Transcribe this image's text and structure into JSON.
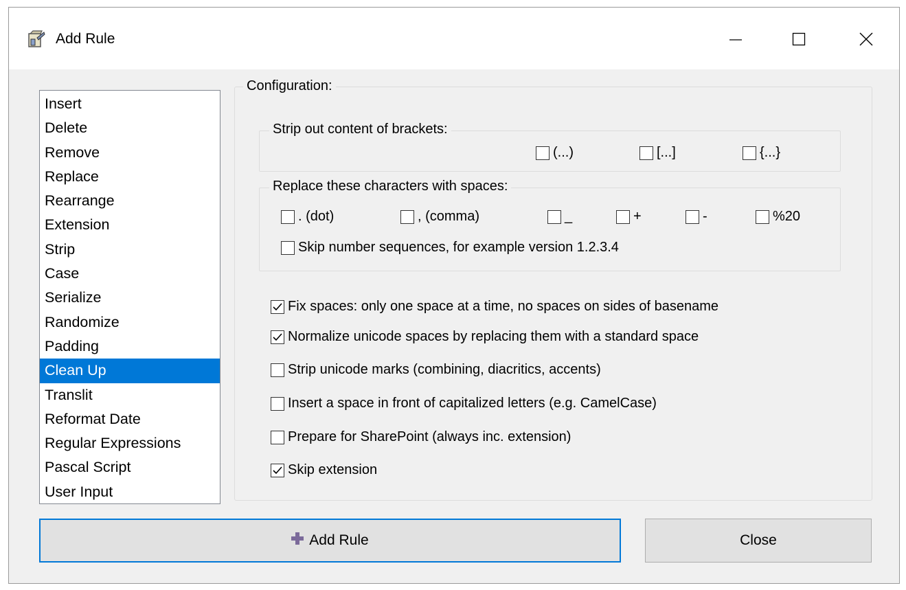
{
  "window": {
    "title": "Add Rule",
    "minimize_label": "Minimize",
    "maximize_label": "Maximize",
    "close_label": "Close window"
  },
  "rules": {
    "items": [
      {
        "label": "Insert",
        "selected": false
      },
      {
        "label": "Delete",
        "selected": false
      },
      {
        "label": "Remove",
        "selected": false
      },
      {
        "label": "Replace",
        "selected": false
      },
      {
        "label": "Rearrange",
        "selected": false
      },
      {
        "label": "Extension",
        "selected": false
      },
      {
        "label": "Strip",
        "selected": false
      },
      {
        "label": "Case",
        "selected": false
      },
      {
        "label": "Serialize",
        "selected": false
      },
      {
        "label": "Randomize",
        "selected": false
      },
      {
        "label": "Padding",
        "selected": false
      },
      {
        "label": "Clean Up",
        "selected": true
      },
      {
        "label": "Translit",
        "selected": false
      },
      {
        "label": "Reformat Date",
        "selected": false
      },
      {
        "label": "Regular Expressions",
        "selected": false
      },
      {
        "label": "Pascal Script",
        "selected": false
      },
      {
        "label": "User Input",
        "selected": false
      }
    ]
  },
  "config": {
    "legend": "Configuration:",
    "brackets": {
      "legend": "Strip out content of brackets:",
      "options": [
        {
          "label": "(...)",
          "checked": false
        },
        {
          "label": "[...]",
          "checked": false
        },
        {
          "label": "{...}",
          "checked": false
        }
      ]
    },
    "replace_chars": {
      "legend": "Replace these characters with spaces:",
      "options": [
        {
          "label": ". (dot)",
          "checked": false
        },
        {
          "label": ", (comma)",
          "checked": false
        },
        {
          "label": "_",
          "checked": false
        },
        {
          "label": "+",
          "checked": false
        },
        {
          "label": "-",
          "checked": false
        },
        {
          "label": "%20",
          "checked": false
        }
      ],
      "skip_numbers": {
        "label": "Skip number sequences, for example version 1.2.3.4",
        "checked": false
      }
    },
    "options": [
      {
        "label": "Fix spaces: only one space at a time, no spaces on sides of basename",
        "checked": true
      },
      {
        "label": "Normalize unicode spaces by replacing them with a standard space",
        "checked": true
      },
      {
        "label": "Strip unicode marks (combining, diacritics, accents)",
        "checked": false
      },
      {
        "label": "Insert a space in front of capitalized letters (e.g. CamelCase)",
        "checked": false
      },
      {
        "label": "Prepare for SharePoint (always inc. extension)",
        "checked": false
      },
      {
        "label": "Skip extension",
        "checked": true
      }
    ]
  },
  "buttons": {
    "add_rule": "Add Rule",
    "close": "Close"
  },
  "colors": {
    "accent": "#0078d7",
    "plus_icon": "#7b6a9a"
  }
}
